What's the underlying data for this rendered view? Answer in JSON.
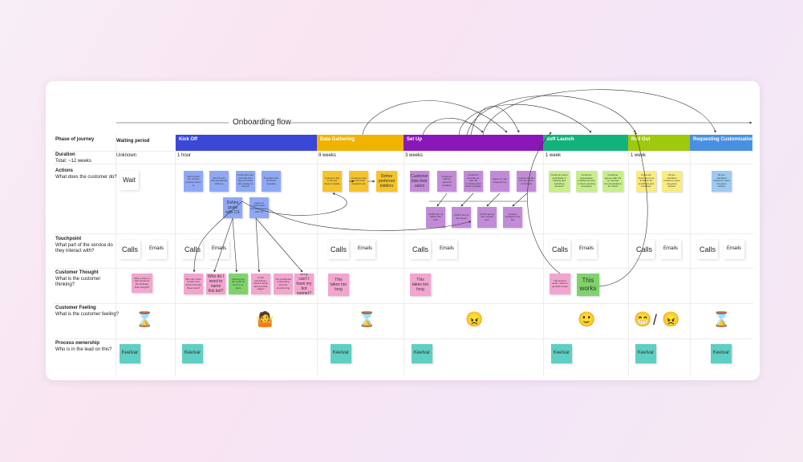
{
  "flow_title": "Onboarding flow",
  "row_labels": {
    "phase": "Phase of journey",
    "duration_title": "Duration",
    "duration_sub": "Total: ~12 weeks",
    "actions_title": "Actions",
    "actions_sub": "What does the customer do?",
    "touchpoint_title": "Touchpoint",
    "touchpoint_sub": "What part of the service do they interact with?",
    "thought_title": "Customer Thought",
    "thought_sub": "What is the customer thinking?",
    "feeling_title": "Customer Feeling",
    "feeling_sub": "What is the customer feeling?",
    "ownership_title": "Process ownership",
    "ownership_sub": "Who is in the lead on this?"
  },
  "waiting": {
    "label": "Waiting period",
    "duration": "Unknown"
  },
  "phases": [
    {
      "label": "Kick Off",
      "color": "#3b47d6",
      "duration": "1 hour"
    },
    {
      "label": "Data Gathering",
      "color": "#f0b400",
      "duration": "9 weeks"
    },
    {
      "label": "Set Up",
      "color": "#8a18b8",
      "duration": "3 weeks"
    },
    {
      "label": "Soft Launch",
      "color": "#12b27c",
      "duration": "1 week"
    },
    {
      "label": "Roll Out",
      "color": "#9ec90d",
      "duration": "1 week"
    },
    {
      "label": "Requesting Customization",
      "color": "#4a90e2",
      "duration": ""
    }
  ],
  "colors": {
    "blue_note": "#8fa8f5",
    "yellow_note": "#f5c42c",
    "purple_note": "#c28bd8",
    "green_note": "#c7ee8a",
    "lightyellow_note": "#f9ec7e",
    "lightblue_note": "#9ccaf2",
    "pink_note": "#f2a5cf",
    "teal_note": "#5fcfc3"
  },
  "notes": {
    "wait": "Wait",
    "k1": "Tell CS who the current process owner is",
    "k2": "Tell CS who the operational staff are",
    "k3": "Customers are told that they need to share all it relates to the tool",
    "k4": "Provided with bid sheet template",
    "k5": "Define goals with CS",
    "k6": "Agree on deliverable communications with CS",
    "d1": "Customer fills in the bid sheet template",
    "d2": "Customer tells us who their suppliers are",
    "d3": "Define preferred bidders",
    "s1": "Customer lists their users",
    "s2": "Customer defines approval workflow",
    "s3": "Customer provides us with the completed bid sheet template",
    "s4": "Agree on rate request form",
    "s5": "Customer tells CS the name of their bot",
    "s6": "CS/PS Set up digital rate card",
    "s7": "CS/PS Set up bid sheets",
    "s8": "CS/PS Set up rate request form",
    "s9": "Keelvar configures the bot",
    "sl1": "Customer users participate in training and workshop sessions",
    "sl2": "Customer organization includes the bot in their sourcing processes",
    "sl3": "Customer agrees with CS on internal communications for rollout",
    "r1": "Customer brainstorms an ambition for workflows and feedback",
    "r2": "All pre-identified customer users are given access",
    "rc1": "All pre-identified customer users are given access",
    "t1": "Why is there a wait period for the software that I bought?",
    "t2": "Why did I have to add more admin than all these tools?",
    "t3": "Who do I need to name this bot?",
    "t4": "Naming the bot could be fun for my team",
    "t5": "Is this something I need to know about at this stage?",
    "t6": "The scheduled onboarding process sounds long",
    "t7": "Why can't I have my bot sooner?",
    "t8": "This takes too long",
    "t9": "This takes too long",
    "t10": "This doesn't work. I want to go back a step",
    "t11": "This works"
  },
  "touch": {
    "calls": "Calls",
    "emails": "Emails"
  },
  "feelings": {
    "waiting": "⌛",
    "kickoff": "🤷",
    "data": "⌛",
    "setup": "😠",
    "softlaunch": "🙂",
    "rollout_a": "😁",
    "rollout_b": "😠",
    "slash": "/",
    "custom": "⌛"
  },
  "owner": "Keelvar"
}
